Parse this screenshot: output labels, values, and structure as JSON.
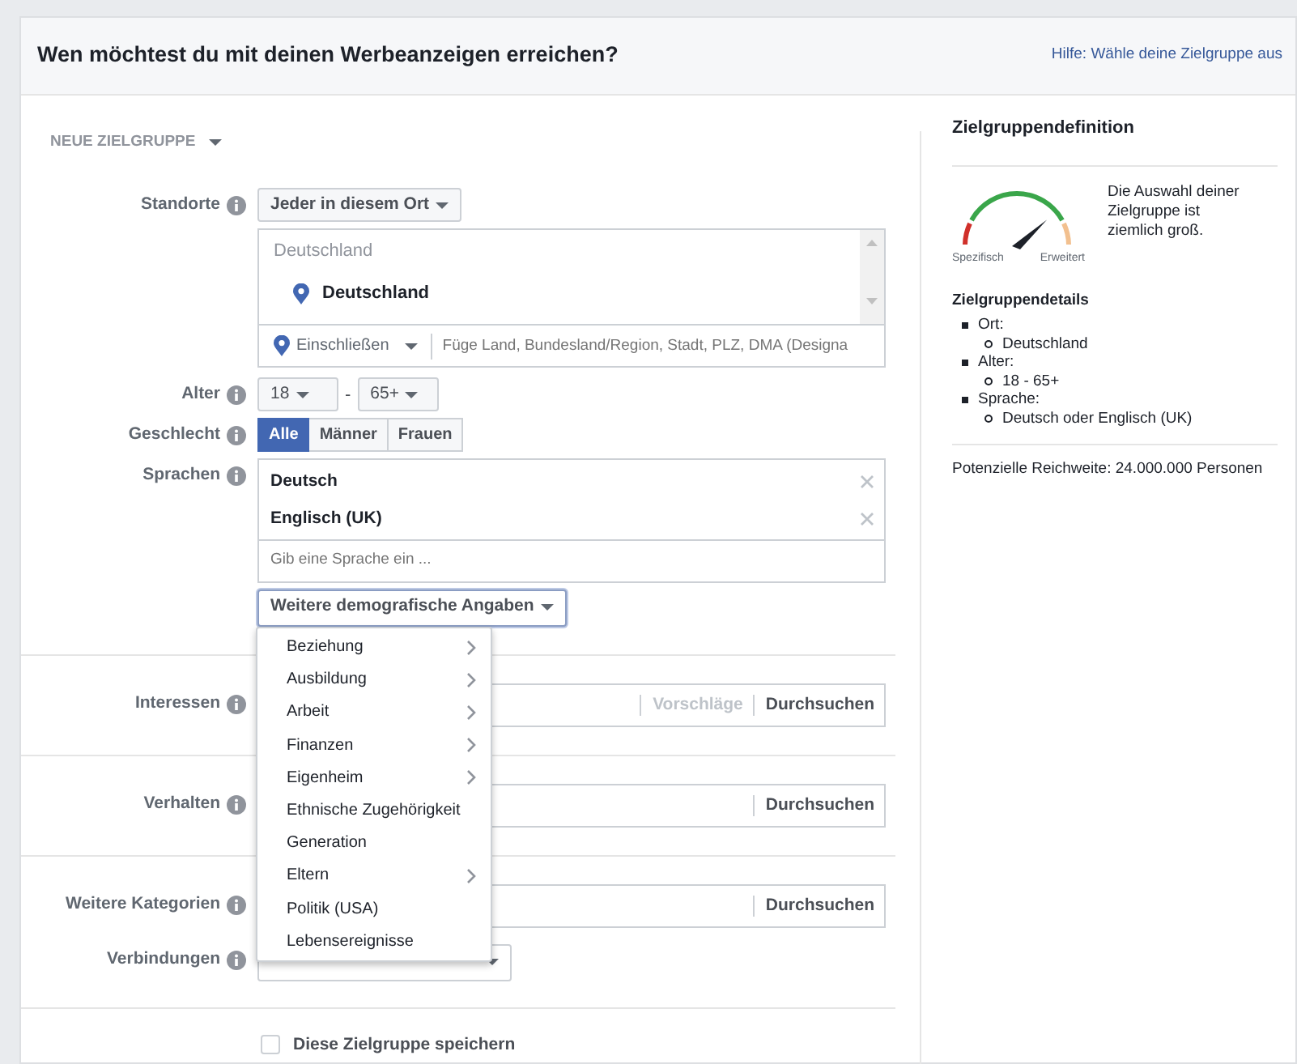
{
  "header": {
    "title": "Wen möchtest du mit deinen Werbeanzeigen erreichen?",
    "help_link": "Hilfe: Wähle deine Zielgruppe aus"
  },
  "audience_menu": {
    "label": "NEUE ZIELGRUPPE"
  },
  "locations": {
    "label": "Standorte",
    "mode": "Jeder in diesem Ort",
    "list_heading": "Deutschland",
    "selected": [
      "Deutschland"
    ],
    "include": "Einschließen",
    "placeholder": "Füge Land, Bundesland/Region, Stadt, PLZ, DMA (Designa"
  },
  "age": {
    "label": "Alter",
    "min": "18",
    "separator": "-",
    "max": "65+"
  },
  "gender": {
    "label": "Geschlecht",
    "options": [
      {
        "label": "Alle",
        "selected": true
      },
      {
        "label": "Männer",
        "selected": false
      },
      {
        "label": "Frauen",
        "selected": false
      }
    ]
  },
  "languages": {
    "label": "Sprachen",
    "items": [
      "Deutsch",
      "Englisch (UK)"
    ],
    "placeholder": "Gib eine Sprache ein ..."
  },
  "more_demographics": {
    "label": "Weitere demografische Angaben",
    "menu": [
      {
        "label": "Beziehung",
        "submenu": true
      },
      {
        "label": "Ausbildung",
        "submenu": true
      },
      {
        "label": "Arbeit",
        "submenu": true
      },
      {
        "label": "Finanzen",
        "submenu": true
      },
      {
        "label": "Eigenheim",
        "submenu": true
      },
      {
        "label": "Ethnische Zugehörigkeit",
        "submenu": false
      },
      {
        "label": "Generation",
        "submenu": false
      },
      {
        "label": "Eltern",
        "submenu": true
      },
      {
        "label": "Politik (USA)",
        "submenu": false
      },
      {
        "label": "Lebensereignisse",
        "submenu": false
      }
    ]
  },
  "targeting": [
    {
      "label": "Interessen",
      "actions": [
        {
          "label": "Vorschläge",
          "disabled": true
        },
        {
          "label": "Durchsuchen",
          "disabled": false
        }
      ]
    },
    {
      "label": "Verhalten",
      "actions": [
        {
          "label": "Durchsuchen",
          "disabled": false
        }
      ]
    },
    {
      "label": "Weitere Kategorien",
      "actions": [
        {
          "label": "Durchsuchen",
          "disabled": false
        }
      ]
    }
  ],
  "connections": {
    "label": "Verbindungen"
  },
  "save": {
    "label": "Diese Zielgruppe speichern",
    "checked": false
  },
  "summary": {
    "title": "Zielgruppendefinition",
    "gauge": {
      "level": 0.78,
      "min_label": "Spezifisch",
      "max_label": "Erweitert",
      "message": "Die Auswahl deiner Zielgruppe ist ziemlich groß."
    },
    "details_title": "Zielgruppendetails",
    "details": [
      {
        "label": "Ort:",
        "values": [
          "Deutschland"
        ]
      },
      {
        "label": "Alter:",
        "values": [
          "18 - 65+"
        ]
      },
      {
        "label": "Sprache:",
        "values": [
          "Deutsch oder Englisch (UK)"
        ]
      }
    ],
    "reach": "Potenzielle Reichweite: 24.000.000 Personen"
  }
}
